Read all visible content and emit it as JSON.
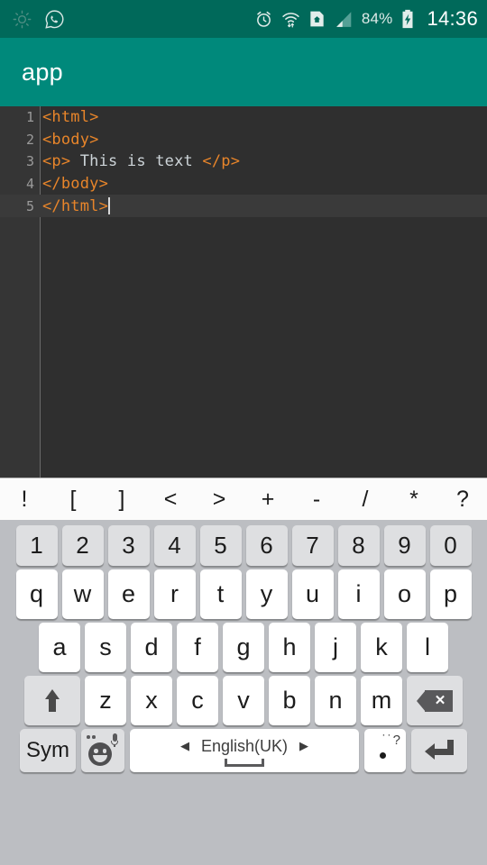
{
  "status_bar": {
    "left_icons": [
      "brightness-sun-icon",
      "whatsapp-icon"
    ],
    "right_icons": [
      "alarm-clock-icon",
      "wifi-icon",
      "home-vpn-icon",
      "signal-bars-icon"
    ],
    "battery_percent": "84%",
    "battery_icon": "battery-charging-icon",
    "clock": "14:36",
    "bg_color": "#00695a"
  },
  "app_bar": {
    "title": "app",
    "bg_color": "#00897b"
  },
  "editor": {
    "bg_color": "#2f2f2f",
    "gutter_color": "#353535",
    "tag_color": "#e8852a",
    "text_color": "#cdd4d8",
    "active_line": 5,
    "lines": [
      {
        "number": "1",
        "tokens": [
          {
            "t": "<html>",
            "type": "tag"
          }
        ]
      },
      {
        "number": "2",
        "tokens": [
          {
            "t": "<body>",
            "type": "tag"
          }
        ]
      },
      {
        "number": "3",
        "tokens": [
          {
            "t": "<p>",
            "type": "tag"
          },
          {
            "t": " This is text ",
            "type": "plain"
          },
          {
            "t": "</p>",
            "type": "tag"
          }
        ]
      },
      {
        "number": "4",
        "tokens": [
          {
            "t": "</body>",
            "type": "tag"
          }
        ]
      },
      {
        "number": "5",
        "tokens": [
          {
            "t": "</html>",
            "type": "tag"
          }
        ],
        "caret": true
      }
    ]
  },
  "symbol_bar": {
    "bg_color": "#fbfbfb",
    "keys": [
      "!",
      "[",
      "]",
      "<",
      ">",
      "+",
      "-",
      "/",
      "*",
      "?"
    ]
  },
  "keyboard": {
    "bg_color": "#bcbec2",
    "key_color": "#ffffff",
    "special_key_color": "#dedfe1",
    "rows": {
      "numbers": [
        "1",
        "2",
        "3",
        "4",
        "5",
        "6",
        "7",
        "8",
        "9",
        "0"
      ],
      "top": [
        "q",
        "w",
        "e",
        "r",
        "t",
        "y",
        "u",
        "i",
        "o",
        "p"
      ],
      "home": [
        "a",
        "s",
        "d",
        "f",
        "g",
        "h",
        "j",
        "k",
        "l"
      ],
      "bottom": [
        "z",
        "x",
        "c",
        "v",
        "b",
        "n",
        "m"
      ]
    },
    "shift_key": {
      "name": "shift-key",
      "icon": "shift-arrow-up-icon"
    },
    "backspace_key": {
      "name": "backspace-key",
      "icon": "backspace-delete-icon"
    },
    "sym_key": {
      "label": "Sym"
    },
    "emoji_key": {
      "name": "emoji-voice-key",
      "icon": "emoji-smiley-microphone-icon"
    },
    "space_key": {
      "language": "English(UK)",
      "prev_arrow": "◀",
      "next_arrow": "▶",
      "icon": "spacebar-glyph"
    },
    "period_key": {
      "main": ".",
      "secondary": "˙˙?"
    },
    "enter_key": {
      "name": "enter-key",
      "icon": "enter-return-icon"
    }
  }
}
